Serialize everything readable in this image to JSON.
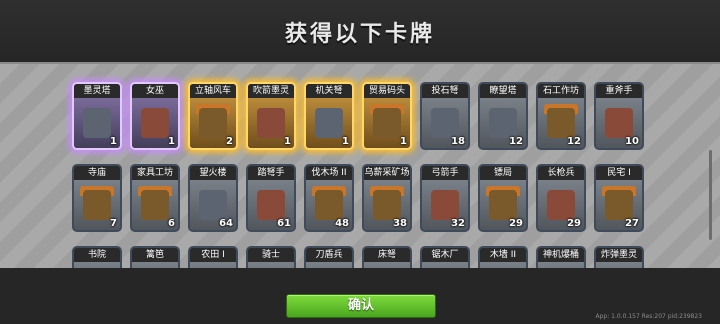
{
  "title": "获得以下卡牌",
  "confirm_label": "确认",
  "version_text": "App: 1.0.0.157 Res:207 pid:239823",
  "colors": {
    "confirm": "#5cbc2a",
    "purple_glow": "#c78cff",
    "gold_glow": "#ffbe28"
  },
  "cards": [
    {
      "name": "墨灵塔",
      "count": "1",
      "rarity": "purple",
      "art": "tower"
    },
    {
      "name": "女巫",
      "count": "1",
      "rarity": "purple",
      "art": "unit"
    },
    {
      "name": "立轴风车",
      "count": "2",
      "rarity": "gold",
      "art": "building"
    },
    {
      "name": "吹箭墨灵",
      "count": "1",
      "rarity": "gold",
      "art": "unit"
    },
    {
      "name": "机关弩",
      "count": "1",
      "rarity": "gold",
      "art": "tower"
    },
    {
      "name": "贸易码头",
      "count": "1",
      "rarity": "gold",
      "art": "building"
    },
    {
      "name": "投石弩",
      "count": "18",
      "rarity": "blue",
      "art": "tower"
    },
    {
      "name": "瞭望塔",
      "count": "12",
      "rarity": "blue",
      "art": "tower"
    },
    {
      "name": "石工作坊",
      "count": "12",
      "rarity": "blue",
      "art": "building"
    },
    {
      "name": "重斧手",
      "count": "10",
      "rarity": "blue",
      "art": "unit"
    },
    {
      "name": "寺庙",
      "count": "7",
      "rarity": "blue",
      "art": "building"
    },
    {
      "name": "家具工坊",
      "count": "6",
      "rarity": "blue",
      "art": "building"
    },
    {
      "name": "望火楼",
      "count": "64",
      "rarity": "blue",
      "art": "tower"
    },
    {
      "name": "踏弩手",
      "count": "61",
      "rarity": "blue",
      "art": "unit"
    },
    {
      "name": "伐木场 II",
      "count": "48",
      "rarity": "blue",
      "art": "building"
    },
    {
      "name": "乌薪采矿场",
      "count": "38",
      "rarity": "blue",
      "art": "building"
    },
    {
      "name": "弓箭手",
      "count": "32",
      "rarity": "blue",
      "art": "unit"
    },
    {
      "name": "镖局",
      "count": "29",
      "rarity": "blue",
      "art": "building"
    },
    {
      "name": "长枪兵",
      "count": "29",
      "rarity": "blue",
      "art": "unit"
    },
    {
      "name": "民宅 I",
      "count": "27",
      "rarity": "blue",
      "art": "building"
    },
    {
      "name": "书院",
      "count": "",
      "rarity": "blue",
      "art": "building"
    },
    {
      "name": "篱笆",
      "count": "",
      "rarity": "blue",
      "art": "building"
    },
    {
      "name": "农田 I",
      "count": "",
      "rarity": "blue",
      "art": "building"
    },
    {
      "name": "骑士",
      "count": "",
      "rarity": "blue",
      "art": "unit"
    },
    {
      "name": "刀盾兵",
      "count": "",
      "rarity": "blue",
      "art": "unit"
    },
    {
      "name": "床弩",
      "count": "",
      "rarity": "blue",
      "art": "tower"
    },
    {
      "name": "锯木厂",
      "count": "",
      "rarity": "blue",
      "art": "building"
    },
    {
      "name": "木墙 II",
      "count": "",
      "rarity": "blue",
      "art": "building"
    },
    {
      "name": "神机爆桶",
      "count": "",
      "rarity": "blue",
      "art": "tower"
    },
    {
      "name": "炸弹墨灵",
      "count": "",
      "rarity": "blue",
      "art": "unit"
    }
  ]
}
